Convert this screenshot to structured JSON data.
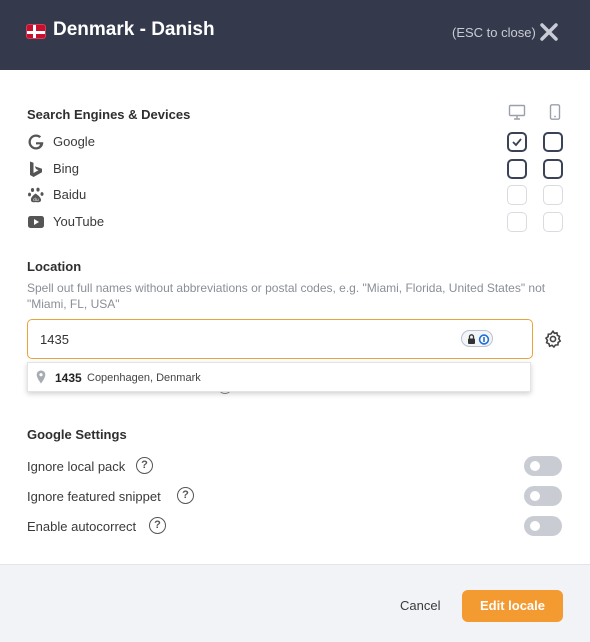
{
  "header": {
    "title": "Denmark - Danish",
    "flag": "denmark-flag",
    "esc_hint": "(ESC to close)",
    "close_icon": "close-icon",
    "background": "#343a4c"
  },
  "engines_section": {
    "title": "Search Engines & Devices",
    "device_columns": [
      "desktop-icon",
      "mobile-icon"
    ],
    "engines": [
      {
        "label": "Google",
        "icon": "google-icon",
        "desktop_checked": true,
        "mobile_checked": false,
        "enabled": true
      },
      {
        "label": "Bing",
        "icon": "bing-icon",
        "desktop_checked": false,
        "mobile_checked": false,
        "enabled": true
      },
      {
        "label": "Baidu",
        "icon": "baidu-icon",
        "desktop_checked": false,
        "mobile_checked": false,
        "enabled": false
      },
      {
        "label": "YouTube",
        "icon": "youtube-icon",
        "desktop_checked": false,
        "mobile_checked": false,
        "enabled": false
      }
    ]
  },
  "location": {
    "title": "Location",
    "help_text": "Spell out full names without abbreviations or postal codes, e.g. \"Miami, Florida, United States\" not \"Miami, FL, USA\"",
    "input_value": "1435",
    "settings_icon": "gear-icon",
    "suggestion": {
      "code": "1435",
      "place": "Copenhagen, Denmark"
    }
  },
  "google_settings": {
    "title": "Google Settings",
    "options": [
      {
        "label": "Ignore local pack",
        "enabled": false
      },
      {
        "label": "Ignore featured snippet",
        "enabled": false
      },
      {
        "label": "Enable autocorrect",
        "enabled": false
      }
    ]
  },
  "footer": {
    "cancel_label": "Cancel",
    "submit_label": "Edit locale",
    "accent": "#f39a30"
  }
}
